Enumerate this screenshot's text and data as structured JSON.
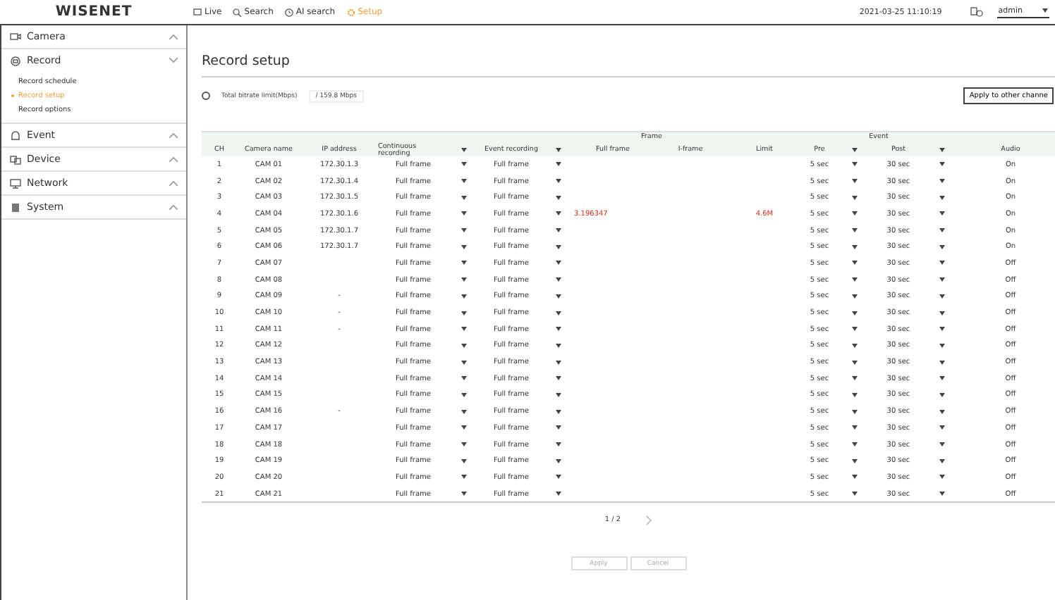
{
  "header": {
    "logo": "WISENET",
    "nav": [
      {
        "label": "Live",
        "selected": false
      },
      {
        "label": "Search",
        "selected": false
      },
      {
        "label": "AI search",
        "selected": false
      },
      {
        "label": "Setup",
        "selected": true
      }
    ],
    "datetime": "2021-03-25 11:10:19",
    "user": "admin"
  },
  "sidebar": {
    "items": [
      {
        "label": "Camera",
        "expanded": false
      },
      {
        "label": "Record",
        "expanded": true,
        "children": [
          {
            "label": "Record schedule",
            "selected": false
          },
          {
            "label": "Record setup",
            "selected": true
          },
          {
            "label": "Record options",
            "selected": false
          }
        ]
      },
      {
        "label": "Event",
        "expanded": false
      },
      {
        "label": "Device",
        "expanded": false
      },
      {
        "label": "Network",
        "expanded": false
      },
      {
        "label": "System",
        "expanded": false
      }
    ]
  },
  "page_title": "Record setup",
  "bitrate": {
    "label": "Total bitrate limit(Mbps)",
    "value": "/ 159.8 Mbps",
    "selected": false
  },
  "apply_button": "Apply to other channe",
  "table": {
    "columns": {
      "ch": "CH",
      "name": "Camera name",
      "ip": "IP address",
      "continuous": "Continuous recording",
      "event": "Event recording",
      "frame": "Frame",
      "full_frame": "Full frame",
      "i_frame": "I-frame",
      "limit": "Limit",
      "event_group": "Event",
      "pre": "Pre",
      "post": "Post",
      "audio": "Audio"
    },
    "rows": [
      {
        "ch": "1",
        "name": "CAM 01",
        "ip": "172.30.1.3",
        "continuous": "Full frame",
        "event": "Full frame",
        "pre": "5 sec",
        "post": "30 sec",
        "audio": "On"
      },
      {
        "ch": "2",
        "name": "CAM 02",
        "ip": "172.30.1.4",
        "continuous": "Full frame",
        "event": "Full frame",
        "pre": "5 sec",
        "post": "30 sec",
        "audio": "On"
      },
      {
        "ch": "3",
        "name": "CAM 03",
        "ip": "172.30.1.5",
        "continuous": "Full frame",
        "event": "Full frame",
        "pre": "5 sec",
        "post": "30 sec",
        "audio": "On"
      },
      {
        "ch": "4",
        "name": "CAM 04",
        "ip": "172.30.1.6",
        "continuous": "Full frame",
        "event": "Full frame",
        "full_frame": "3.196347",
        "limit": "4.6M",
        "pre": "5 sec",
        "post": "30 sec",
        "audio": "On"
      },
      {
        "ch": "5",
        "name": "CAM 05",
        "ip": "172.30.1.7",
        "continuous": "Full frame",
        "event": "Full frame",
        "pre": "5 sec",
        "post": "30 sec",
        "audio": "On"
      },
      {
        "ch": "6",
        "name": "CAM 06",
        "ip": "172.30.1.7",
        "continuous": "Full frame",
        "event": "Full frame",
        "pre": "5 sec",
        "post": "30 sec",
        "audio": "On"
      },
      {
        "ch": "7",
        "name": "CAM 07",
        "continuous": "Full frame",
        "event": "Full frame",
        "pre": "5 sec",
        "post": "30 sec",
        "audio": "Off"
      },
      {
        "ch": "8",
        "name": "CAM 08",
        "continuous": "Full frame",
        "event": "Full frame",
        "pre": "5 sec",
        "post": "30 sec",
        "audio": "Off"
      },
      {
        "ch": "9",
        "name": "CAM 09",
        "ip": "-",
        "continuous": "Full frame",
        "event": "Full frame",
        "pre": "5 sec",
        "post": "30 sec",
        "audio": "Off"
      },
      {
        "ch": "10",
        "name": "CAM 10",
        "ip": "-",
        "continuous": "Full frame",
        "event": "Full frame",
        "pre": "5 sec",
        "post": "30 sec",
        "audio": "Off"
      },
      {
        "ch": "11",
        "name": "CAM 11",
        "ip": "-",
        "continuous": "Full frame",
        "event": "Full frame",
        "pre": "5 sec",
        "post": "30 sec",
        "audio": "Off"
      },
      {
        "ch": "12",
        "name": "CAM 12",
        "continuous": "Full frame",
        "event": "Full frame",
        "pre": "5 sec",
        "post": "30 sec",
        "audio": "Off"
      },
      {
        "ch": "13",
        "name": "CAM 13",
        "continuous": "Full frame",
        "event": "Full frame",
        "pre": "5 sec",
        "post": "30 sec",
        "audio": "Off"
      },
      {
        "ch": "14",
        "name": "CAM 14",
        "continuous": "Full frame",
        "event": "Full frame",
        "pre": "5 sec",
        "post": "30 sec",
        "audio": "Off"
      },
      {
        "ch": "15",
        "name": "CAM 15",
        "continuous": "Full frame",
        "event": "Full frame",
        "pre": "5 sec",
        "post": "30 sec",
        "audio": "Off"
      },
      {
        "ch": "16",
        "name": "CAM 16",
        "ip": "-",
        "continuous": "Full frame",
        "event": "Full frame",
        "pre": "5 sec",
        "post": "30 sec",
        "audio": "Off"
      },
      {
        "ch": "17",
        "name": "CAM 17",
        "continuous": "Full frame",
        "event": "Full frame",
        "pre": "5 sec",
        "post": "30 sec",
        "audio": "Off"
      },
      {
        "ch": "18",
        "name": "CAM 18",
        "continuous": "Full frame",
        "event": "Full frame",
        "pre": "5 sec",
        "post": "30 sec",
        "audio": "Off"
      },
      {
        "ch": "19",
        "name": "CAM 19",
        "continuous": "Full frame",
        "event": "Full frame",
        "pre": "5 sec",
        "post": "30 sec",
        "audio": "Off"
      },
      {
        "ch": "20",
        "name": "CAM 20",
        "continuous": "Full frame",
        "event": "Full frame",
        "pre": "5 sec",
        "post": "30 sec",
        "audio": "Off"
      },
      {
        "ch": "21",
        "name": "CAM 21",
        "continuous": "Full frame",
        "event": "Full frame",
        "pre": "5 sec",
        "post": "30 sec",
        "audio": "Off"
      }
    ]
  },
  "pagination": {
    "page": "1 / 2"
  },
  "buttons": [
    "Apply",
    "Cancel"
  ]
}
